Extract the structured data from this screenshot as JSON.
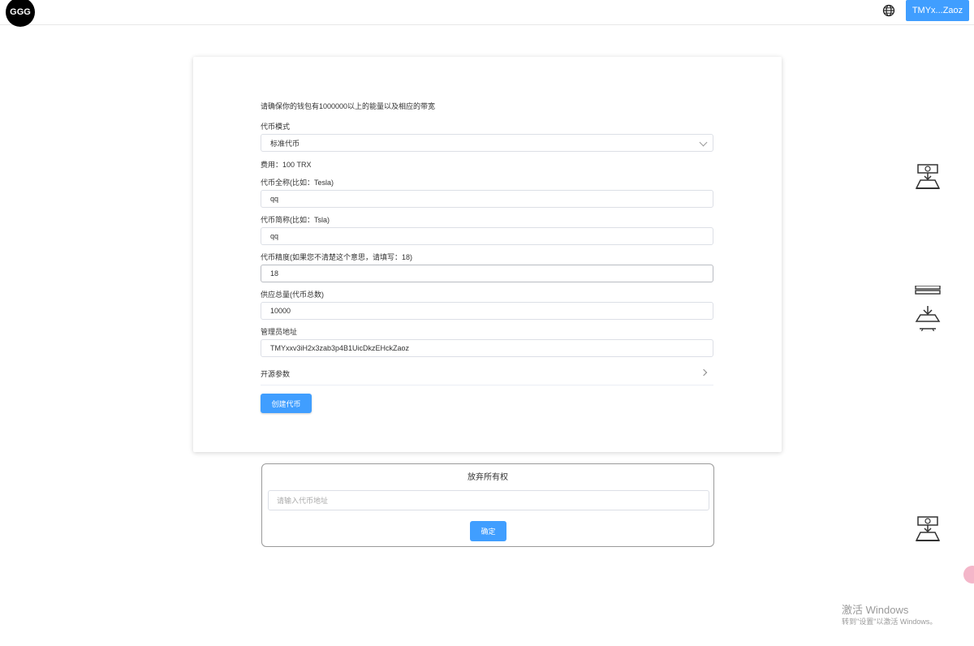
{
  "header": {
    "logo_text": "GGG",
    "wallet_button": "TMYx...Zaoz",
    "language_icon": "globe-icon"
  },
  "form": {
    "notice": "请确保你的钱包有1000000以上的能量以及相应的带宽",
    "token_mode_label": "代币模式",
    "token_mode_value": "标准代币",
    "fee_text": "费用：100 TRX",
    "full_name_label": "代币全称(比如：Tesla)",
    "full_name_value": "qq",
    "short_name_label": "代币简称(比如：Tsla)",
    "short_name_value": "qq",
    "precision_label": "代币精度(如果您不清楚这个意思，请填写：18)",
    "precision_value": "18",
    "supply_label": "供应总量(代币总数)",
    "supply_value": "10000",
    "admin_label": "管理员地址",
    "admin_value": "TMYxxv3iH2x3zab3p4B1UicDkzEHckZaoz",
    "advanced_label": "开源参数",
    "create_button": "创建代币"
  },
  "renounce": {
    "title": "放弃所有权",
    "input_placeholder": "请输入代币地址",
    "confirm_button": "确定"
  },
  "side_icons": [
    "cash-register-icon",
    "cash-register-icon",
    "cash-register-icon"
  ],
  "watermark": {
    "line1": "激活 Windows",
    "line2": "转到\"设置\"以激活 Windows。"
  },
  "colors": {
    "primary": "#409eff",
    "border": "#dcdfe6"
  }
}
